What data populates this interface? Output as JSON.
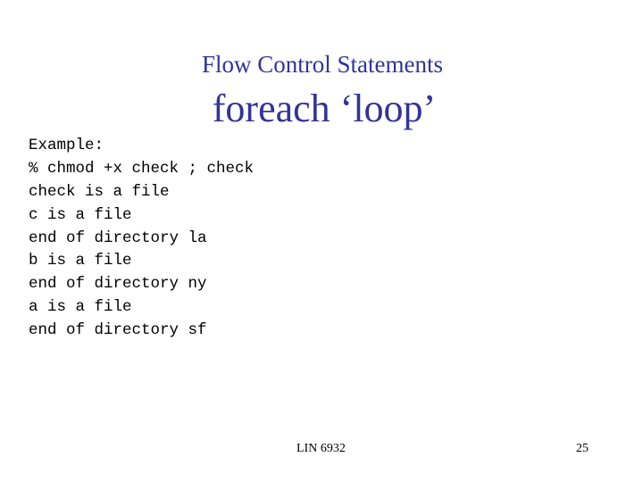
{
  "slide": {
    "title": {
      "line1": "Flow Control Statements",
      "line2": "foreach ‘loop’",
      "color": "#333399"
    },
    "body_lines": [
      "Example:",
      "% chmod +x check ; check",
      "check is a file",
      "c is a file",
      "end of directory la",
      "b is a file",
      "end of directory ny",
      "a is a file",
      "end of directory sf"
    ],
    "footer": {
      "course": "LIN 6932",
      "page_number": "25"
    }
  }
}
